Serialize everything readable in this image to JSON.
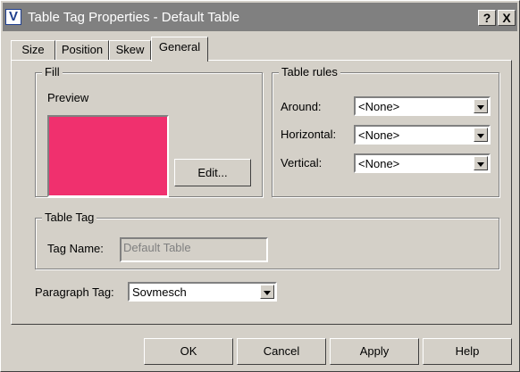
{
  "window": {
    "title": "Table Tag Properties - Default Table",
    "app_icon_letter": "V"
  },
  "titlebar_buttons": {
    "help": "?",
    "close": "X"
  },
  "tabs": [
    {
      "label": "Size"
    },
    {
      "label": "Position"
    },
    {
      "label": "Skew"
    },
    {
      "label": "General"
    }
  ],
  "active_tab": "General",
  "fill": {
    "legend": "Fill",
    "preview_label": "Preview",
    "preview_color": "#f0306e",
    "edit_label": "Edit..."
  },
  "table_rules": {
    "legend": "Table rules",
    "around_label": "Around:",
    "around_value": "<None>",
    "horizontal_label": "Horizontal:",
    "horizontal_value": "<None>",
    "vertical_label": "Vertical:",
    "vertical_value": "<None>"
  },
  "table_tag": {
    "legend": "Table Tag",
    "tag_name_label": "Tag Name:",
    "tag_name_value": "Default Table"
  },
  "paragraph_tag": {
    "label": "Paragraph Tag:",
    "value": "Sovmesch"
  },
  "footer": {
    "ok": "OK",
    "cancel": "Cancel",
    "apply": "Apply",
    "help": "Help"
  }
}
